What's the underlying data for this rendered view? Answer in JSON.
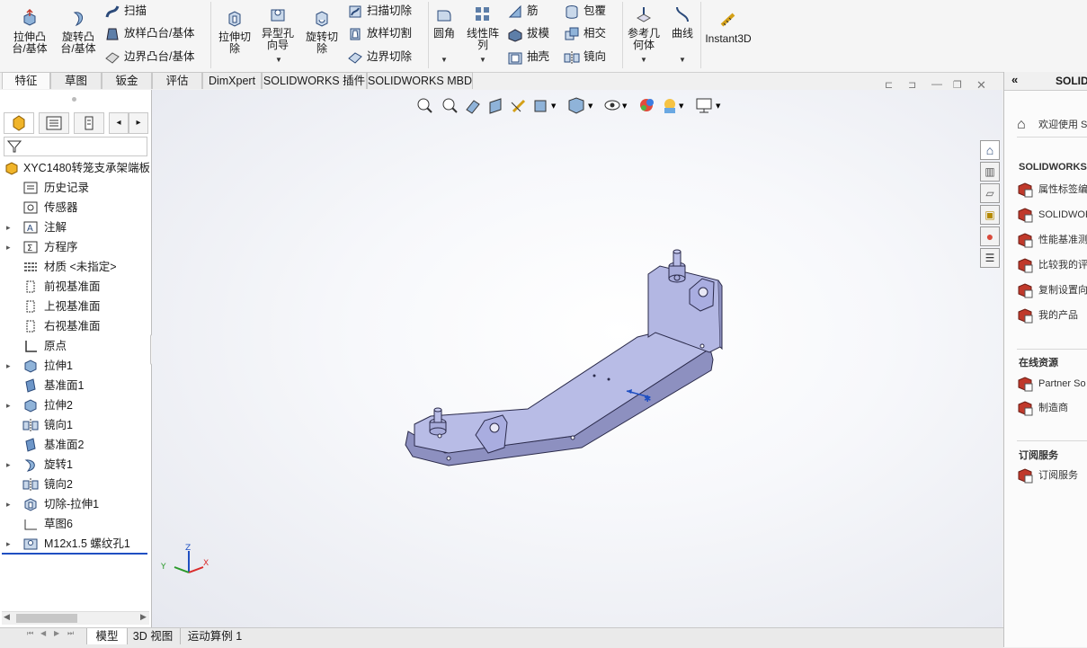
{
  "ribbon": {
    "extrude_boss": "拉伸凸\n台/基体",
    "revolve_boss": "旋转凸\n台/基体",
    "sweep": "扫描",
    "loft_boss": "放样凸台/基体",
    "boundary_boss": "边界凸台/基体",
    "extrude_cut": "拉伸切\n除",
    "hole_wizard": "异型孔\n向导",
    "revolve_cut": "旋转切\n除",
    "swept_cut": "扫描切除",
    "lofted_cut": "放样切割",
    "boundary_cut": "边界切除",
    "fillet": "圆角",
    "linear_pattern": "线性阵\n列",
    "rib": "筋",
    "draft": "拔模",
    "shell": "抽壳",
    "wrap": "包覆",
    "intersect": "相交",
    "mirror": "镜向",
    "ref_geometry": "参考几\n何体",
    "curves": "曲线",
    "instant3d": "Instant3D"
  },
  "tabs": [
    "特征",
    "草图",
    "钣金",
    "评估",
    "DimXpert",
    "SOLIDWORKS 插件",
    "SOLIDWORKS MBD"
  ],
  "tree": {
    "root": "XYC1480转笼支承架端板",
    "items": [
      {
        "label": "历史记录",
        "icon": "history-icon",
        "exp": false
      },
      {
        "label": "传感器",
        "icon": "sensor-icon",
        "exp": false
      },
      {
        "label": "注解",
        "icon": "annotation-icon",
        "exp": true
      },
      {
        "label": "方程序",
        "icon": "equation-icon",
        "exp": true
      },
      {
        "label": "材质 <未指定>",
        "icon": "material-icon",
        "exp": false
      },
      {
        "label": "前视基准面",
        "icon": "plane-icon",
        "exp": false
      },
      {
        "label": "上视基准面",
        "icon": "plane-icon",
        "exp": false
      },
      {
        "label": "右视基准面",
        "icon": "plane-icon",
        "exp": false
      },
      {
        "label": "原点",
        "icon": "origin-icon",
        "exp": false
      },
      {
        "label": "拉伸1",
        "icon": "extrude-icon",
        "exp": true
      },
      {
        "label": "基准面1",
        "icon": "plane-solid-icon",
        "exp": false
      },
      {
        "label": "拉伸2",
        "icon": "extrude-icon",
        "exp": true
      },
      {
        "label": "镜向1",
        "icon": "mirror-icon",
        "exp": false
      },
      {
        "label": "基准面2",
        "icon": "plane-solid-icon",
        "exp": false
      },
      {
        "label": "旋转1",
        "icon": "revolve-icon",
        "exp": true
      },
      {
        "label": "镜向2",
        "icon": "mirror-icon",
        "exp": false
      },
      {
        "label": "切除-拉伸1",
        "icon": "cut-extrude-icon",
        "exp": true
      },
      {
        "label": "草图6",
        "icon": "sketch-icon",
        "exp": false
      },
      {
        "label": "M12x1.5 螺纹孔1",
        "icon": "hole-icon",
        "exp": true
      }
    ]
  },
  "bottom_tabs": [
    "模型",
    "3D 视图",
    "运动算例 1"
  ],
  "right_panel": {
    "title": "SOLID",
    "welcome": "欢迎使用 S",
    "section1": "SOLIDWORKS",
    "items1": [
      "属性标签编",
      "SOLIDWOR",
      "性能基准测",
      "比较我的评",
      "复制设置向",
      "我的产品"
    ],
    "section2": "在线资源",
    "items2": [
      "Partner So",
      "制造商"
    ],
    "section3": "订阅服务",
    "items3": [
      "订阅服务"
    ]
  },
  "triad": {
    "x": "X",
    "y": "Y",
    "z": "Z"
  },
  "colors": {
    "part": "#b8bce6",
    "part_edge": "#2a2a4a",
    "accent_blue": "#1f4fc2"
  }
}
